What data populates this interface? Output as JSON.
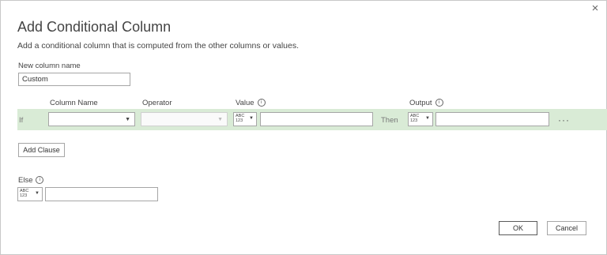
{
  "dialog": {
    "title": "Add Conditional Column",
    "subtitle": "Add a conditional column that is computed from the other columns or values."
  },
  "new_column": {
    "label": "New column name",
    "value": "Custom"
  },
  "clause_headers": {
    "column_name": "Column Name",
    "operator": "Operator",
    "value": "Value",
    "output": "Output"
  },
  "clause": {
    "if_label": "If",
    "then_label": "Then",
    "column_name_value": "",
    "operator_value": "",
    "value_type_icon": "abc-123-type-icon",
    "value_type_glyph_top": "ABC",
    "value_type_glyph_bottom": "123",
    "value_value": "",
    "output_type_glyph_top": "ABC",
    "output_type_glyph_bottom": "123",
    "output_value": "",
    "more_label": "···"
  },
  "add_clause": {
    "label": "Add Clause"
  },
  "else": {
    "label": "Else",
    "type_glyph_top": "ABC",
    "type_glyph_bottom": "123",
    "value": ""
  },
  "footer": {
    "ok_label": "OK",
    "cancel_label": "Cancel"
  },
  "icons": {
    "close": "×",
    "info": "i",
    "caret": "▼"
  }
}
